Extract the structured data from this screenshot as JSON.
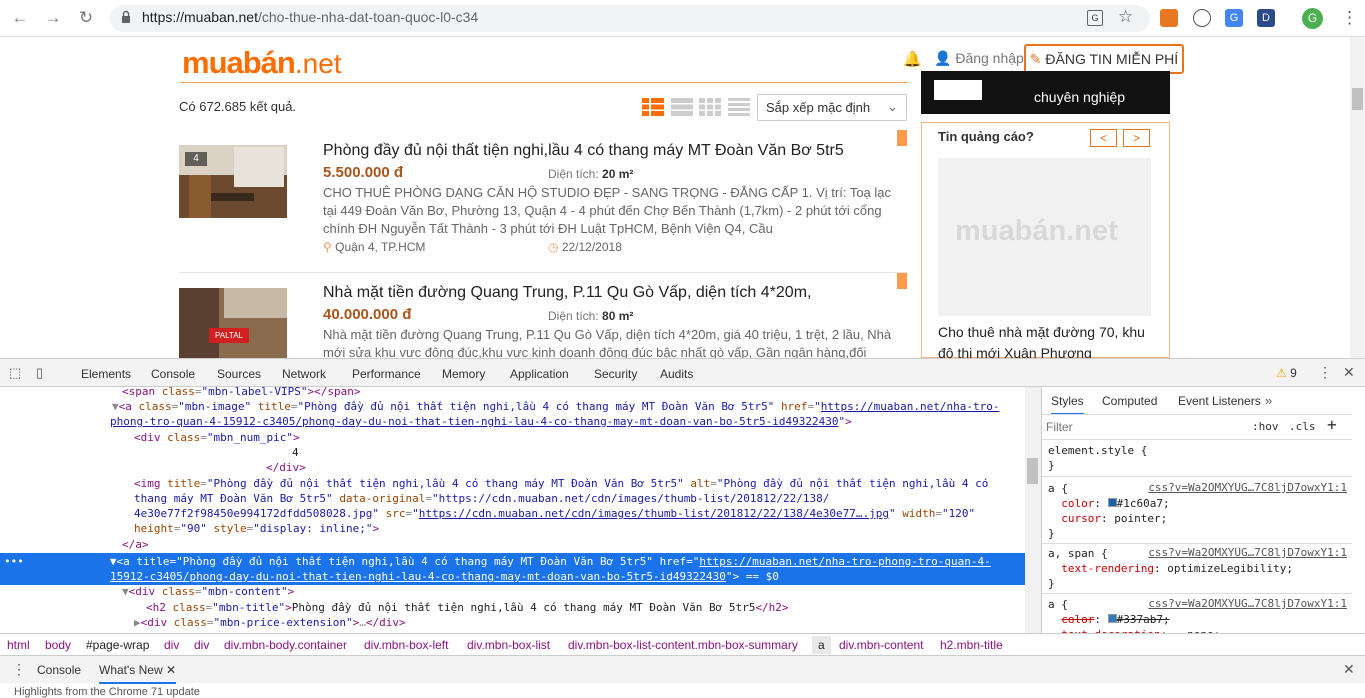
{
  "browser": {
    "url_host": "https://muaban.net",
    "url_path": "/cho-thue-nha-dat-toan-quoc-l0-c34",
    "profile_initial": "G",
    "ext_d": "D"
  },
  "site": {
    "logo_main": "muabán",
    "logo_tld": ".net",
    "login": "Đăng nhập",
    "post_button": "ĐĂNG TIN MIỄN PHÍ",
    "result_count": "Có 672.685 kết quả.",
    "sort": "Sắp xếp mặc định",
    "listings": [
      {
        "badge": "4",
        "title": "Phòng đầy đủ nội thất tiện nghi,lầu 4 có thang máy MT Đoàn Văn Bơ 5tr5",
        "price": "5.500.000 đ",
        "area_label": "Diện tích:",
        "area_value": "20 m²",
        "desc": "CHO THUÊ PHÒNG DẠNG CĂN HỘ STUDIO ĐẸP - SANG TRỌNG - ĐẲNG CẤP 1. Vị trí: Toạ lạc tại 449 Đoàn Văn Bơ, Phường 13, Quận 4 - 4 phút đến Chợ Bến Thành (1,7km) - 2 phút tới cổng chính ĐH Nguyễn Tất Thành - 3 phút tới ĐH Luật TpHCM, Bệnh Viện Q4, Cầu",
        "location": "Quận 4, TP.HCM",
        "date": "22/12/2018"
      },
      {
        "title": "Nhà mặt tiền đường Quang Trung, P.11 Qu Gò Vấp, diện tích 4*20m,",
        "price": "40.000.000 đ",
        "area_label": "Diện tích:",
        "area_value": "80 m²",
        "desc": "Nhà mặt tiền đường Quang Trung, P.11 Qu Gò Vấp, diện tích 4*20m, giá 40 triệu, 1 trệt, 2 lầu, Nhà mới sửa khu vực đông đúc,khu vực kinh doanh đông đúc bậc nhất gò vấp, Gần ngân hàng,đối",
        "sign_text": "PALTAL"
      }
    ],
    "banner_text": "chuyên nghiệp",
    "ad_title": "Tin quảng cáo?",
    "ad_prev": "<",
    "ad_next": ">",
    "ad_logo": "muabán.net",
    "ad_text": "Cho thuê nhà mặt đường 70, khu đô thị mới Xuân Phương"
  },
  "devtools": {
    "tabs": [
      "Elements",
      "Console",
      "Sources",
      "Network",
      "Performance",
      "Memory",
      "Application",
      "Security",
      "Audits"
    ],
    "warn_count": "9",
    "styles_tabs": [
      "Styles",
      "Computed",
      "Event Listeners"
    ],
    "filter_placeholder": "Filter",
    "hov": ":hov",
    "cls": ".cls",
    "breadcrumbs": [
      "html",
      "body",
      "#page-wrap",
      "div",
      "div",
      "div.mbn-body.container",
      "div.mbn-box-left",
      "div.mbn-box-list",
      "div.mbn-box-list-content.mbn-box-summary",
      "a",
      "div.mbn-content",
      "h2.mbn-title"
    ],
    "drawer_tabs": [
      "Console",
      "What's New"
    ],
    "bottom_text": "Highlights from the Chrome 71 update"
  }
}
